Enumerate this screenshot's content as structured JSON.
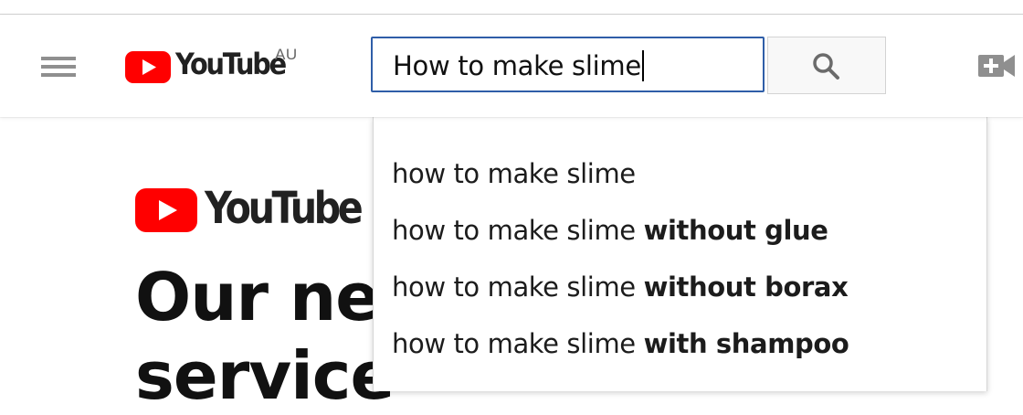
{
  "header": {
    "logo_text": "YouTube",
    "country_code": "AU",
    "search_value": "How to make slime"
  },
  "content": {
    "music_logo_text": "YouTube M",
    "headline_line1": "Our new",
    "headline_line2": "service"
  },
  "suggestions": [
    {
      "prefix": "how to make slime",
      "completion": ""
    },
    {
      "prefix": "how to make slime",
      "completion": "without glue"
    },
    {
      "prefix": "how to make slime",
      "completion": "without borax"
    },
    {
      "prefix": "how to make slime",
      "completion": "with shampoo"
    }
  ],
  "icons": {
    "menu": "hamburger-menu-icon",
    "logo": "youtube-play-logo",
    "search": "search-icon",
    "upload": "video-camera-add-icon"
  },
  "colors": {
    "brand_red": "#ff0000",
    "focus_border": "#2f5ea8",
    "icon_grey": "#8f8f8f"
  }
}
